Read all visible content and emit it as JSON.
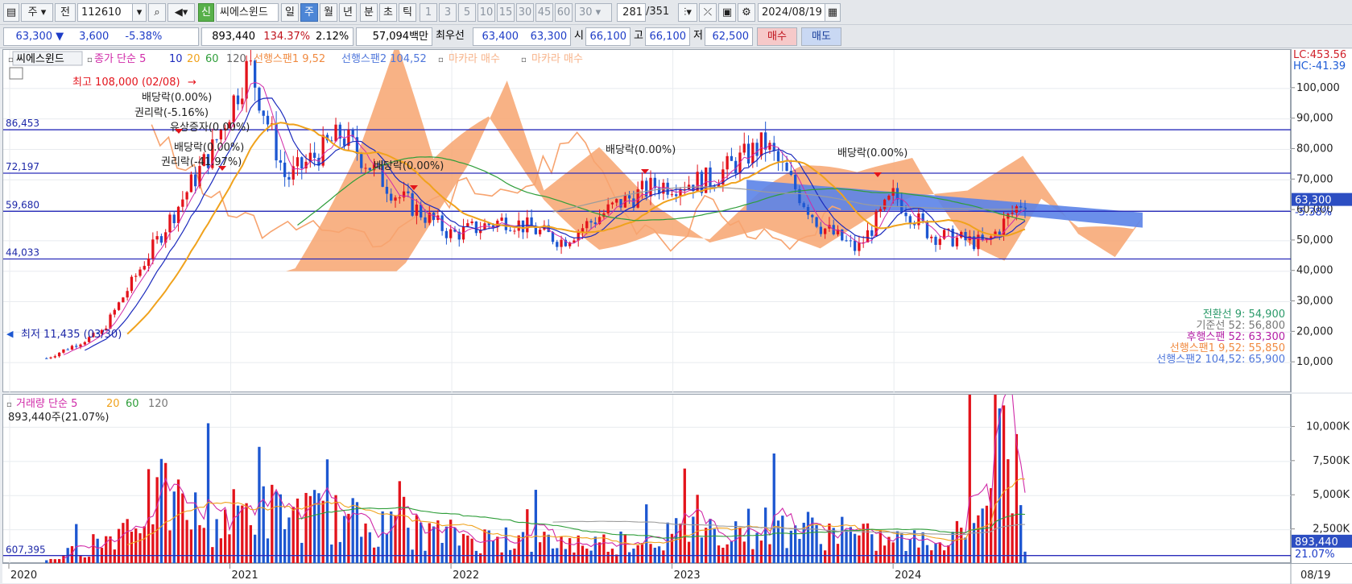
{
  "toolbar": {
    "period_label": "주",
    "prev_label": "전",
    "code": "112610",
    "name": "씨에스윈드",
    "sin_label": "신",
    "periods": [
      "일",
      "주",
      "월",
      "년",
      "분",
      "초",
      "틱"
    ],
    "active_period": "주",
    "intervals": [
      "1",
      "3",
      "5",
      "10",
      "15",
      "30",
      "45",
      "60"
    ],
    "interval_select": "30",
    "count": "281",
    "count_total": "/351",
    "date": "2024/08/19"
  },
  "info": {
    "price": "63,300",
    "change": "3,600",
    "change_pct": "-5.38%",
    "volume": "893,440",
    "volume_ratio": "134.37%",
    "turnover": "2.12%",
    "amount": "57,094백만",
    "best_label": "최우선",
    "best_ask": "63,400",
    "best_bid": "63,300",
    "open_label": "시",
    "open": "66,100",
    "high_label": "고",
    "high": "66,100",
    "low_label": "저",
    "low": "62,500",
    "buy_label": "매수",
    "sell_label": "매도"
  },
  "price_legend": {
    "stock": "씨에스윈드",
    "close_ma": "종가 단순 5",
    "ma10": "10",
    "ma20": "20",
    "ma60": "60",
    "ma120": "120",
    "span1": "선행스팬1 9,52",
    "span2": "선행스팬2 104,52",
    "macara1": "마카라 매수",
    "macara2": "마카라 매수"
  },
  "right_badges": {
    "lc": "LC:453.56",
    "hc": "HC:-41.39"
  },
  "price_axis_labels": [
    "100,000",
    "90,000",
    "80,000",
    "70,000",
    "60,000",
    "50,000",
    "40,000",
    "30,000",
    "20,000",
    "10,000"
  ],
  "hlines": [
    "86,453",
    "72,197",
    "59,680",
    "44,033"
  ],
  "current_price_tag": "63,300",
  "current_change_tag": "-5.38%",
  "annotations": {
    "high": "최고 108,000 (02/08)",
    "low": "최저 11,435 (03/30)",
    "div1": "배당락(0.00%)",
    "rights1": "권리락(-5.16%)",
    "paid_incr": "유상증자(0.00%)",
    "div2": "배당락(0.00%)",
    "rights2": "권리락(-41.97%)",
    "div3": "배당락(0.00%)",
    "div4": "배당락(0.00%)",
    "div5": "배당락(0.00%)"
  },
  "ichimoku_values": {
    "conversion": "전환선 9: 54,900",
    "base": "기준선 52: 56,800",
    "lagging": "후행스팬 52: 63,300",
    "span1": "선행스팬1 9,52: 55,850",
    "span2": "선행스팬2 104,52: 65,900"
  },
  "volume_legend": {
    "label": "거래량 단순 5",
    "ma20": "20",
    "ma60": "60",
    "ma120": "120",
    "current": "893,440주(21.07%)"
  },
  "volume_axis_labels": [
    "10,000K",
    "7,500K",
    "5,000K",
    "2,500K"
  ],
  "volume_left_label": "607,395",
  "volume_tag": "893,440",
  "volume_tag_pct": "21.07%",
  "x_labels": [
    "2020",
    "2021",
    "2022",
    "2023",
    "2024"
  ],
  "x_right_label": "08/19",
  "colors": {
    "up": "#e3131b",
    "down": "#1d57d1",
    "ma5": "#d02aa8",
    "ma10": "#1c2bbd",
    "ma20": "#f0a21c",
    "ma60": "#2f9e3a",
    "ma120": "#9c9c9c",
    "cloud_up": "#f7a470",
    "cloud_down": "#5b83e8",
    "hline": "#2a2dbb"
  },
  "chart_data": {
    "type": "candlestick",
    "title": "씨에스윈드",
    "ylim": [
      0,
      110000
    ],
    "x_range": [
      "2020",
      "2024/08/19"
    ],
    "levels": [
      86453,
      72197,
      59680,
      44033
    ],
    "price_path": [
      [
        "2020-03",
        11435
      ],
      [
        "2020-06",
        20000
      ],
      [
        "2020-09",
        50000
      ],
      [
        "2020-12",
        80000
      ],
      [
        "2021-02",
        108000
      ],
      [
        "2021-04",
        70000
      ],
      [
        "2021-07",
        85000
      ],
      [
        "2021-10",
        65000
      ],
      [
        "2022-01",
        52000
      ],
      [
        "2022-04",
        57000
      ],
      [
        "2022-07",
        50000
      ],
      [
        "2022-10",
        62000
      ],
      [
        "2022-12",
        68000
      ],
      [
        "2023-03",
        70000
      ],
      [
        "2023-06",
        82000
      ],
      [
        "2023-09",
        55000
      ],
      [
        "2023-11",
        47000
      ],
      [
        "2024-01",
        65000
      ],
      [
        "2024-03",
        52000
      ],
      [
        "2024-06",
        49000
      ],
      [
        "2024-08",
        63300
      ]
    ],
    "volume_path_k": [
      [
        "2020-03",
        300
      ],
      [
        "2020-06",
        1500
      ],
      [
        "2020-09",
        5000
      ],
      [
        "2020-12",
        3000
      ],
      [
        "2021-02",
        4000
      ],
      [
        "2021-06",
        3500
      ],
      [
        "2021-10",
        2500
      ],
      [
        "2022-03",
        1800
      ],
      [
        "2022-09",
        1500
      ],
      [
        "2023-03",
        2500
      ],
      [
        "2023-07",
        2800
      ],
      [
        "2023-12",
        1800
      ],
      [
        "2024-04",
        1500
      ],
      [
        "2024-07",
        9500
      ],
      [
        "2024-08",
        893
      ]
    ]
  }
}
